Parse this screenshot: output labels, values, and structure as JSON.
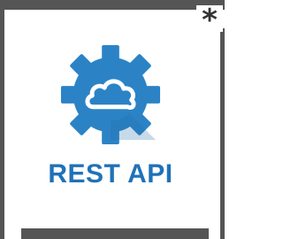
{
  "corner_mark": "*",
  "logo": {
    "text": "REST API",
    "icon": "gear-cloud-icon",
    "colors": {
      "gear": "#2b83c6",
      "cloud": "#ffffff",
      "text": "#1f72b8",
      "frame": "#555555"
    }
  }
}
